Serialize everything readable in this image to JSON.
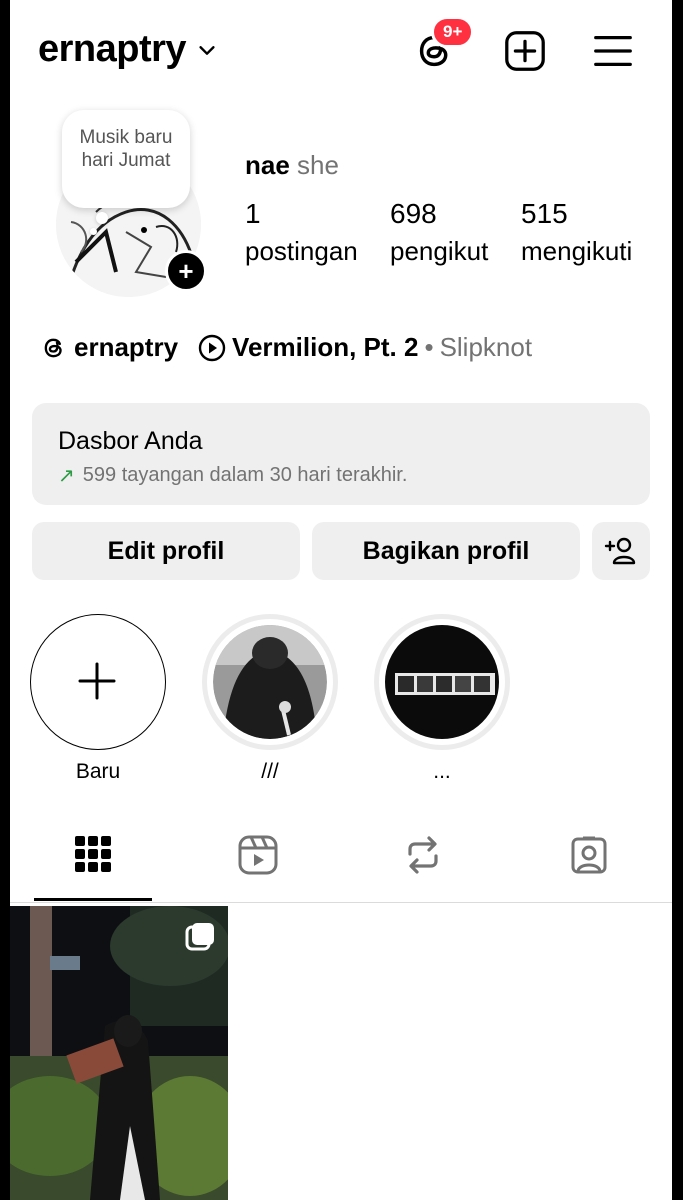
{
  "header": {
    "username": "ernaptry",
    "threads_badge": "9+"
  },
  "profile": {
    "note": "Musik baru hari Jumat",
    "display_name": "nae",
    "pronoun": "she",
    "stats": [
      {
        "value": "1",
        "label": "postingan"
      },
      {
        "value": "698",
        "label": "pengikut"
      },
      {
        "value": "515",
        "label": "mengikuti"
      }
    ],
    "threads_handle": "ernaptry",
    "music": {
      "song": "Vermilion, Pt. 2",
      "separator": "•",
      "artist": "Slipknot"
    }
  },
  "dashboard": {
    "title": "Dasbor Anda",
    "subtitle": "599 tayangan dalam 30 hari terakhir."
  },
  "buttons": {
    "edit": "Edit profil",
    "share": "Bagikan profil"
  },
  "highlights": [
    {
      "label": "Baru"
    },
    {
      "label": "///"
    },
    {
      "label": "..."
    }
  ],
  "tabs": [
    "grid-icon",
    "reels-icon",
    "reposts-icon",
    "tagged-icon"
  ],
  "colors": {
    "badge": "#ff3040",
    "trend": "#2e9b45",
    "muted": "#737373",
    "button_bg": "#efefef"
  }
}
